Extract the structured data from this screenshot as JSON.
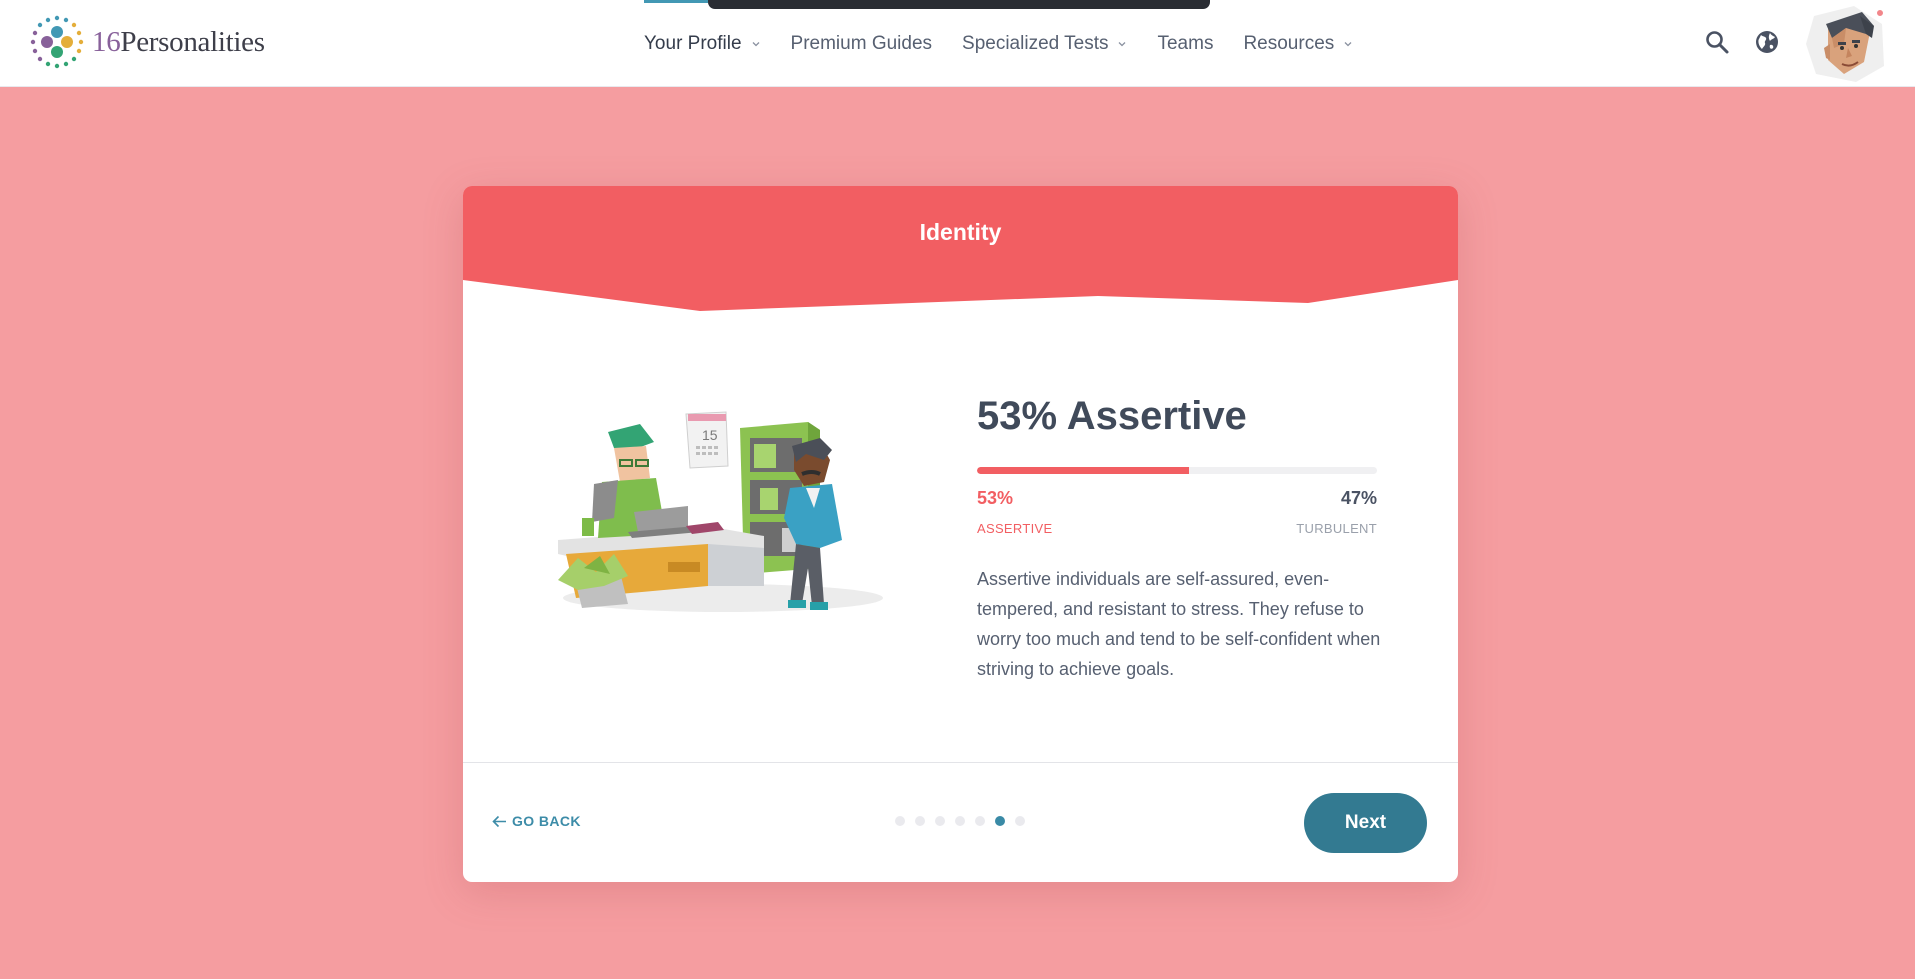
{
  "header": {
    "logo_number": "16",
    "logo_word": "Personalities",
    "nav": [
      {
        "label": "Your Profile",
        "dropdown": true,
        "active": true
      },
      {
        "label": "Premium Guides",
        "dropdown": false
      },
      {
        "label": "Specialized Tests",
        "dropdown": true
      },
      {
        "label": "Teams",
        "dropdown": false
      },
      {
        "label": "Resources",
        "dropdown": true
      }
    ],
    "icons": [
      "search-icon",
      "globe-icon",
      "user-avatar"
    ]
  },
  "card": {
    "title": "Identity",
    "result_title": "53% Assertive",
    "bar": {
      "assertive_fraction": 0.53
    },
    "left_percent": "53%",
    "left_label": "ASSERTIVE",
    "right_percent": "47%",
    "right_label": "TURBULENT",
    "description": "Assertive individuals are self-assured, even-tempered, and resistant to stress. They refuse to worry too much and tend to be self-confident when striving to achieve goals.",
    "illustration_calendar_number": "15",
    "go_back_label": "GO BACK",
    "steps_total": 7,
    "steps_current": 6,
    "next_label": "Next"
  },
  "colors": {
    "page_background": "#f59da0",
    "header_band": "#f25e62",
    "accent_teal": "#337a91",
    "link_teal": "#3d8ca8"
  }
}
